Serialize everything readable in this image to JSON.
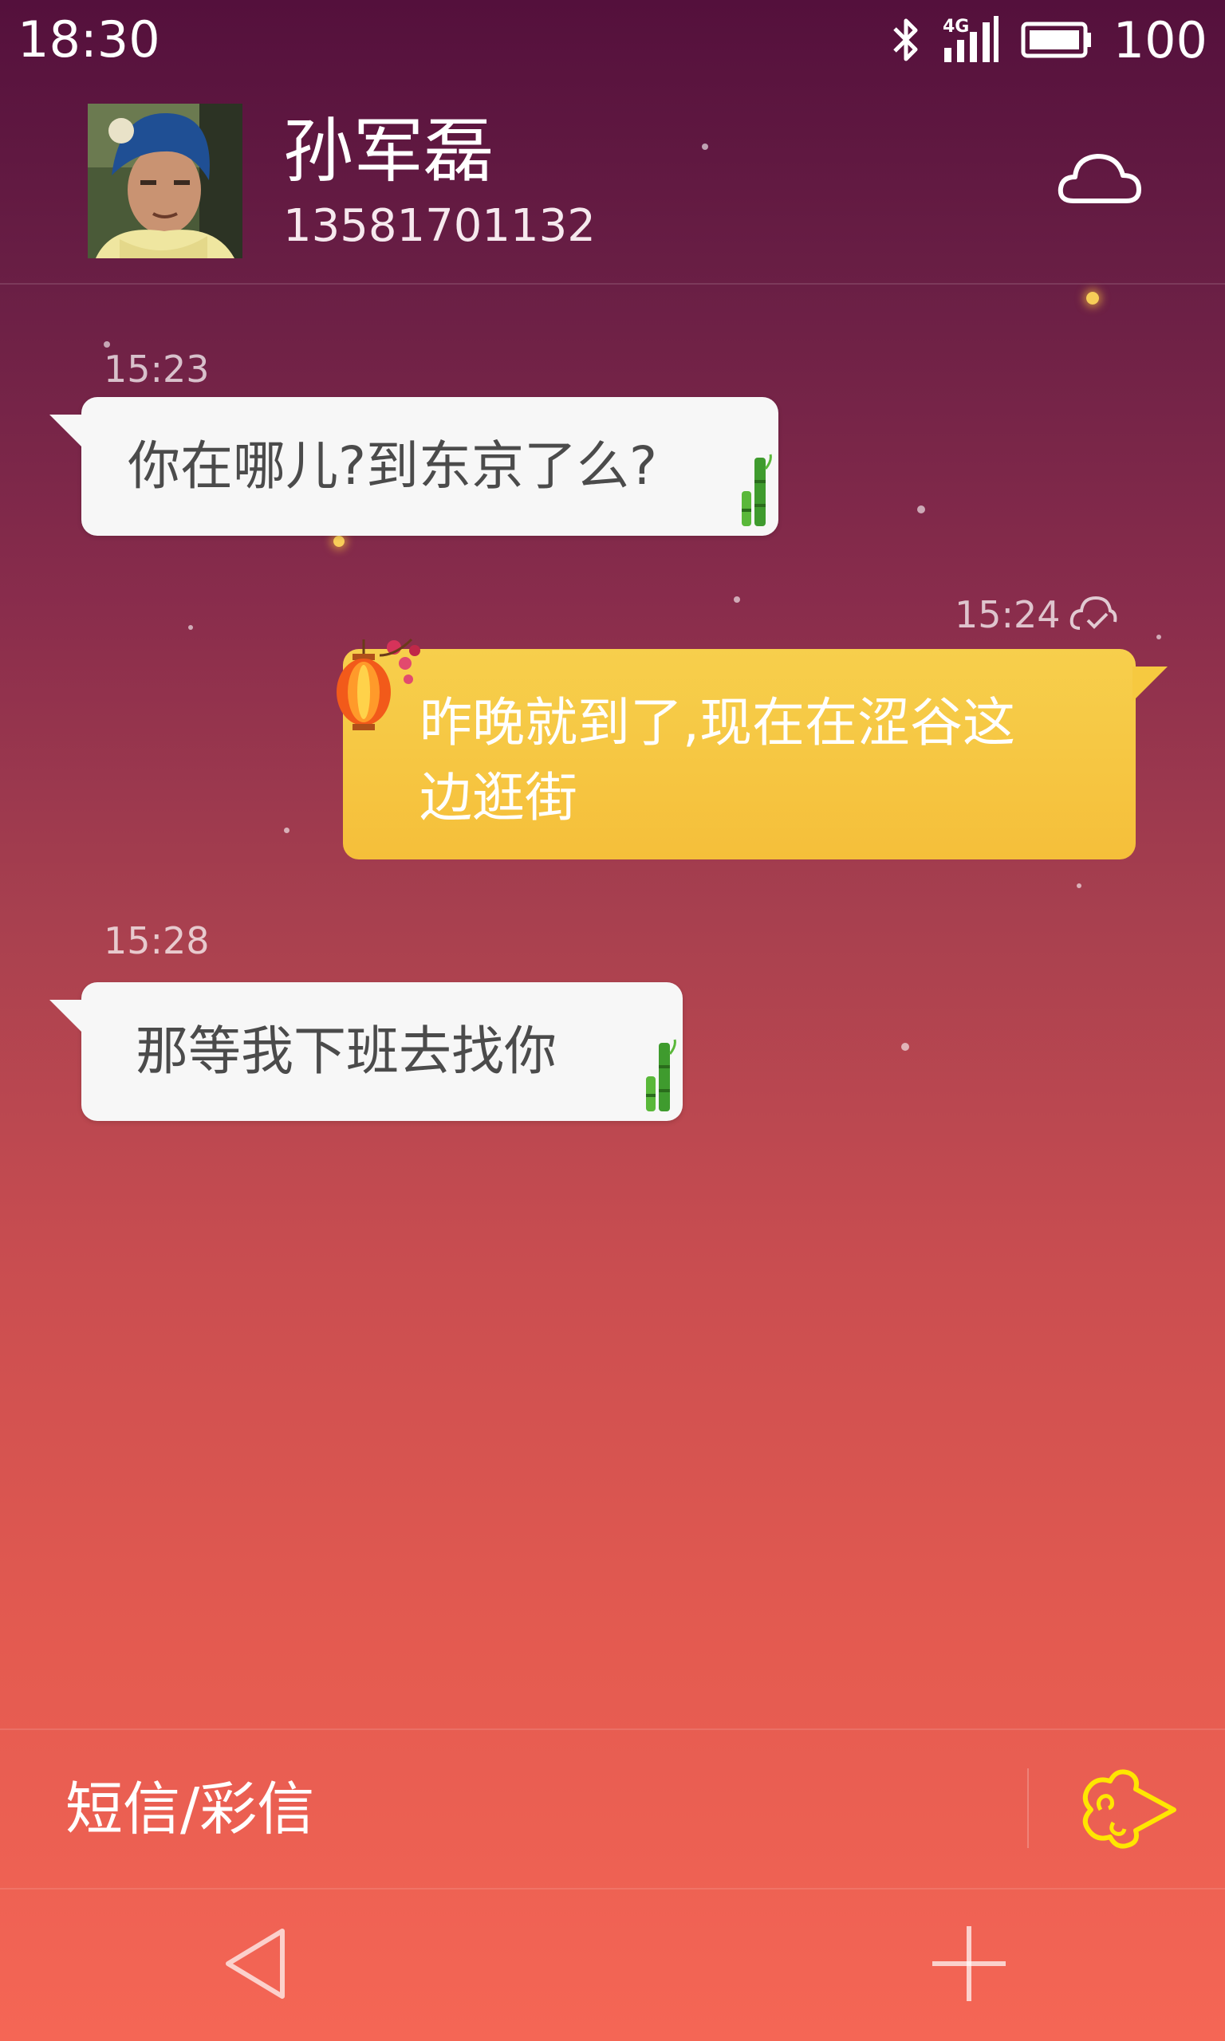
{
  "status_bar": {
    "time": "18:30",
    "network": "4G",
    "battery": "100",
    "icons": [
      "bluetooth-icon",
      "signal-icon",
      "battery-icon"
    ]
  },
  "header": {
    "contact_name": "孙军磊",
    "contact_number": "13581701132",
    "cloud_icon": "cloud-icon"
  },
  "messages": [
    {
      "direction": "incoming",
      "time": "15:23",
      "text": "你在哪儿?到东京了么?"
    },
    {
      "direction": "outgoing",
      "time": "15:24",
      "text_line1": "昨晚就到了,现在在涩谷这",
      "text_line2": "边逛街",
      "status_icon": "cloud-check-icon"
    },
    {
      "direction": "incoming",
      "time": "15:28",
      "text": "那等我下班去找你"
    }
  ],
  "composer": {
    "placeholder": "短信/彩信",
    "send_icon": "auspicious-cloud-send-icon"
  },
  "nav": {
    "back_icon": "back-triangle-icon",
    "add_icon": "plus-icon"
  },
  "colors": {
    "incoming_bubble": "#f7f7f7",
    "outgoing_bubble": "#f6c940",
    "send_icon": "#ffe600"
  }
}
